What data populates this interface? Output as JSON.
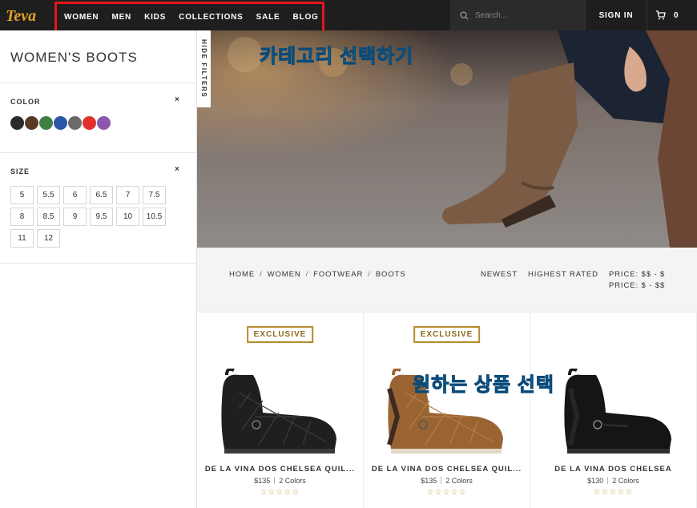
{
  "brand": {
    "logo_text": "Teva"
  },
  "nav": {
    "items": [
      {
        "label": "WOMEN"
      },
      {
        "label": "MEN"
      },
      {
        "label": "KIDS"
      },
      {
        "label": "COLLECTIONS"
      },
      {
        "label": "SALE"
      },
      {
        "label": "BLOG"
      }
    ]
  },
  "search": {
    "placeholder": "Search..."
  },
  "account": {
    "sign_in_label": "SIGN IN",
    "cart_count": "0"
  },
  "sidebar": {
    "title": "WOMEN'S BOOTS",
    "hide_filters_label": "HIDE FILTERS",
    "color_filter": {
      "label": "COLOR",
      "close": "×",
      "swatches": [
        "#2b2b2b",
        "#5a3b27",
        "#3f7f46",
        "#2a57a6",
        "#6a6a6a",
        "#e2312b",
        "#8e56ad"
      ]
    },
    "size_filter": {
      "label": "SIZE",
      "close": "×",
      "sizes": [
        "5",
        "5.5",
        "6",
        "6.5",
        "7",
        "7.5",
        "8",
        "8.5",
        "9",
        "9.5",
        "10",
        "10.5",
        "11",
        "12"
      ]
    }
  },
  "annotations": {
    "category": "카테고리 선택하기",
    "product": "원하는 상품 선택"
  },
  "breadcrumb": [
    "HOME",
    "WOMEN",
    "FOOTWEAR",
    "BOOTS"
  ],
  "breadcrumb_sep": "/",
  "sort": {
    "newest": "NEWEST",
    "highest_rated": "HIGHEST RATED",
    "price_high": "PRICE: $$ - $",
    "price_low": "PRICE: $ - $$"
  },
  "products": [
    {
      "badge": "EXCLUSIVE",
      "name": "DE LA VINA DOS CHELSEA QUIL...",
      "price": "$135",
      "colors": "2 Colors",
      "color": "black-quilted"
    },
    {
      "badge": "EXCLUSIVE",
      "name": "DE LA VINA DOS CHELSEA QUIL...",
      "price": "$135",
      "colors": "2 Colors",
      "color": "tan-quilted"
    },
    {
      "badge": "",
      "name": "DE LA VINA DOS CHELSEA",
      "price": "$130",
      "colors": "2 Colors",
      "color": "black-leather"
    }
  ],
  "stars": "☆☆☆☆☆",
  "colors": {
    "accent_gold": "#b78a2c",
    "nav_bg": "#1e1e1e",
    "highlight_red": "#e8141b"
  }
}
